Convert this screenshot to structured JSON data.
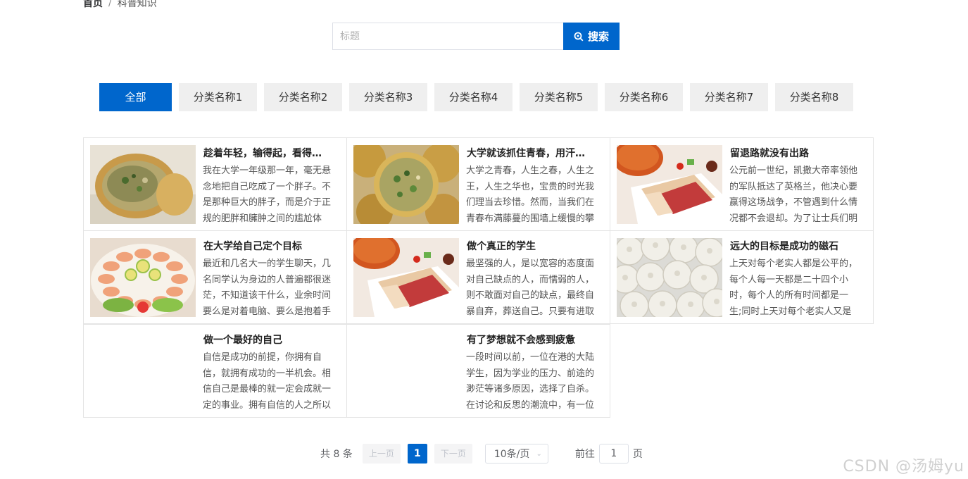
{
  "breadcrumb": {
    "home": "首页",
    "separator": "/",
    "current": "科普知识"
  },
  "search": {
    "placeholder": "标题",
    "value": "",
    "button_label": "搜索"
  },
  "tabs": [
    {
      "label": "全部",
      "active": true
    },
    {
      "label": "分类名称1"
    },
    {
      "label": "分类名称2"
    },
    {
      "label": "分类名称3"
    },
    {
      "label": "分类名称4"
    },
    {
      "label": "分类名称5"
    },
    {
      "label": "分类名称6"
    },
    {
      "label": "分类名称7"
    },
    {
      "label": "分类名称8"
    }
  ],
  "articles": [
    {
      "title": "趁着年轻，输得起，看得…",
      "desc": "我在大学一年级那一年，毫无悬念地把自己吃成了一个胖子。不是那种巨大的胖子，而是介于正规的肥胖和臃肿之间的尴尬体",
      "image": "fried-dumpling"
    },
    {
      "title": "大学就该抓住青春，用汗…",
      "desc": "大学之青春，人生之春，人生之王，人生之华也，宝贵的时光我们理当去珍惜。然而，当我们在青春布满藤蔓的围墙上缓慢的攀",
      "image": "fried-pancakes"
    },
    {
      "title": "留退路就没有出路",
      "desc": "公元前一世纪，凯撒大帝率领他的军队抵达了英格兰，他决心要赢得这场战争，不管遇到什么情况都不会退却。为了让士兵们明",
      "image": "cured-pork"
    },
    {
      "title": "在大学给自己定个目标",
      "desc": "最近和几名大一的学生聊天，几名同学认为身边的人普遍都很迷茫，不知道该干什么，业余时间要么是对着电脑、要么是抱着手",
      "image": "shrimp-platter"
    },
    {
      "title": "做个真正的学生",
      "desc": "最坚强的人，是以宽容的态度面对自己缺点的人，而懦弱的人，则不敢面对自己的缺点，最终自暴自弃，葬送自己。只要有进取",
      "image": "cured-pork"
    },
    {
      "title": "远大的目标是成功的磁石",
      "desc": "上天对每个老实人都是公平的，每个人每一天都是二十四个小时，每个人的所有时间都是一生;同时上天对每个老实人又是",
      "image": "steamed-buns"
    },
    {
      "title": "做一个最好的自己",
      "desc": "自信是成功的前提，你拥有自信，就拥有成功的一半机会。相信自己是最棒的就一定会成就一定的事业。拥有自信的人之所以",
      "image": ""
    },
    {
      "title": "有了梦想就不会感到疲惫",
      "desc": "一段时间以前，一位在港的大陆学生，因为学业的压力、前途的渺茫等诸多原因，选择了自杀。在讨论和反思的潮流中，有一位",
      "image": ""
    }
  ],
  "pagination": {
    "total": "共 8 条",
    "prev": "上一页",
    "page": "1",
    "next": "下一页",
    "page_size": "10条/页",
    "goto_label": "前往",
    "goto_value": "1",
    "page_suffix": "页"
  },
  "watermark": "CSDN @汤姆yu",
  "colors": {
    "primary": "#0066cc",
    "tab_bg": "#efefef",
    "border": "#e4e4e4"
  }
}
